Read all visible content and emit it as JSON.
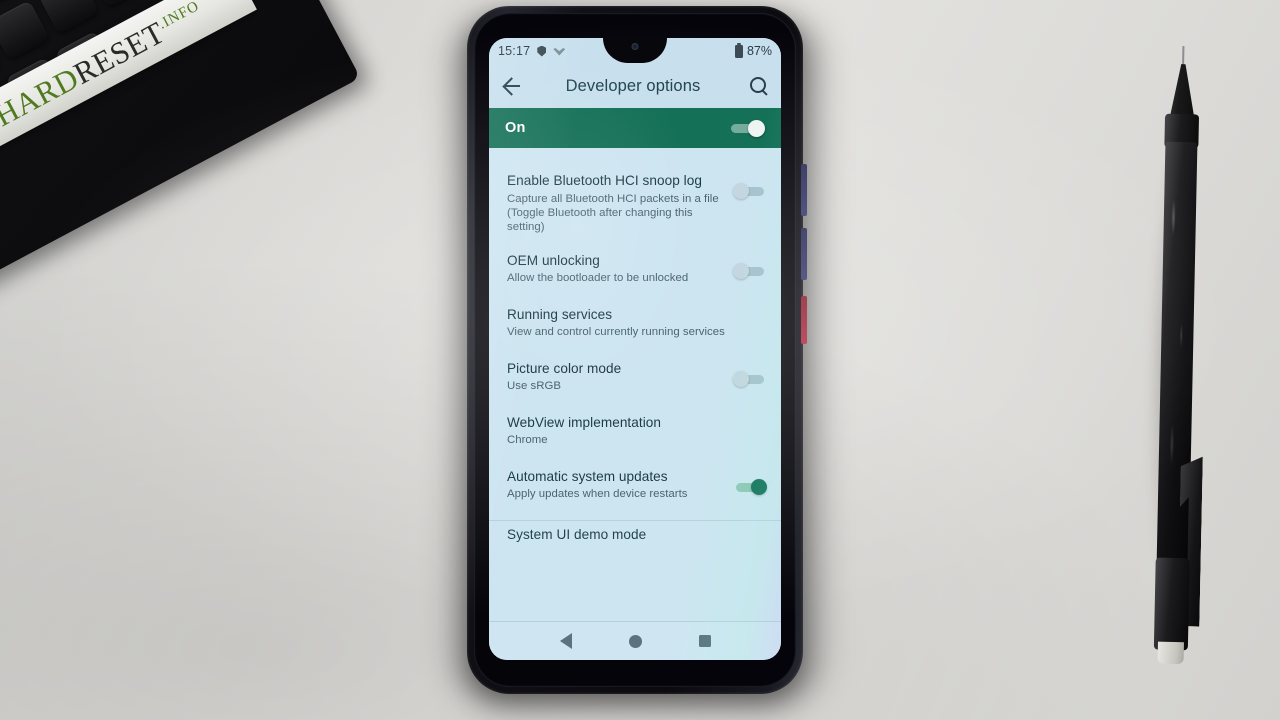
{
  "watermark": {
    "part1": "HARD",
    "part2": "RESET",
    "part3": ".INFO"
  },
  "phone": {
    "statusbar": {
      "time": "15:17",
      "icons_left": [
        "shield-icon",
        "wifi-icon"
      ],
      "battery_percent": "87%",
      "battery_icon": "battery-icon"
    },
    "toolbar": {
      "back_icon": "back-arrow-icon",
      "title": "Developer options",
      "search_icon": "search-icon"
    },
    "master_switch": {
      "label": "On",
      "state": "on"
    },
    "settings": [
      {
        "title": "Enable Bluetooth HCI snoop log",
        "subtitle": "Capture all Bluetooth HCI packets in a file (Toggle Bluetooth after changing this setting)",
        "control": "toggle",
        "state": "off"
      },
      {
        "title": "OEM unlocking",
        "subtitle": "Allow the bootloader to be unlocked",
        "control": "toggle",
        "state": "off"
      },
      {
        "title": "Running services",
        "subtitle": "View and control currently running services",
        "control": "none",
        "state": ""
      },
      {
        "title": "Picture color mode",
        "subtitle": "Use sRGB",
        "control": "toggle",
        "state": "off"
      },
      {
        "title": "WebView implementation",
        "subtitle": "Chrome",
        "control": "none",
        "state": ""
      },
      {
        "title": "Automatic system updates",
        "subtitle": "Apply updates when device restarts",
        "control": "toggle",
        "state": "on"
      },
      {
        "title": "System UI demo mode",
        "subtitle": "",
        "control": "none",
        "state": ""
      }
    ],
    "navbar": {
      "back": "nav-back-icon",
      "home": "nav-home-icon",
      "recents": "nav-recents-icon"
    },
    "side_buttons": [
      "volume-up-button",
      "volume-down-button",
      "power-button"
    ]
  },
  "colors": {
    "accent_green": "#147057",
    "toolbar_bg": "#c8e0ee",
    "list_bg": "#cde5f1",
    "title_text": "#1d3b45",
    "sub_text": "#4a6570",
    "toggle_on": "#13705a",
    "watermark_green": "#4f7a1d"
  }
}
